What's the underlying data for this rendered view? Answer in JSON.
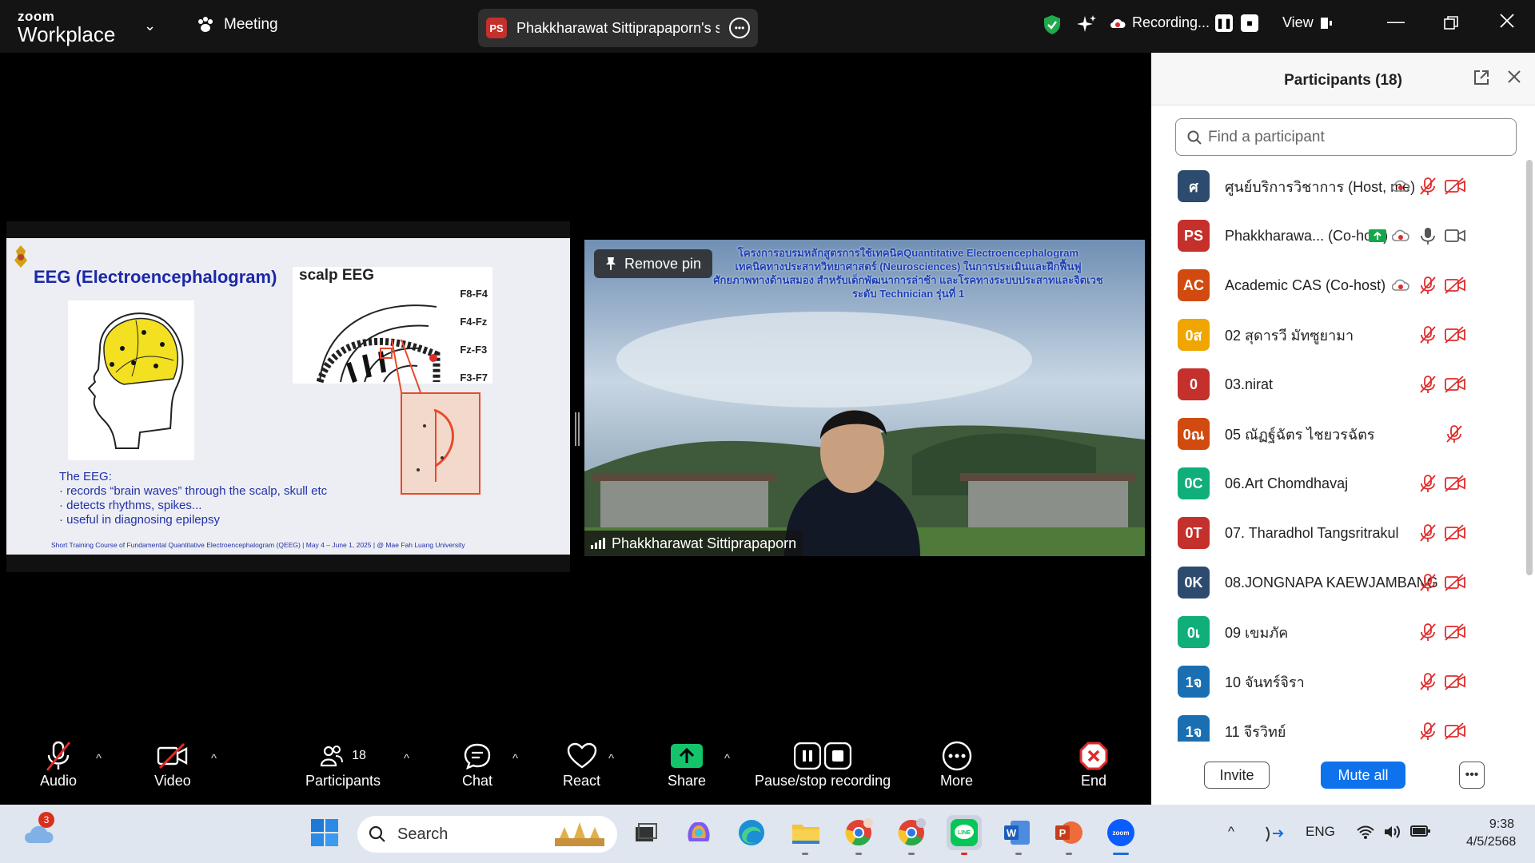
{
  "titlebar": {
    "logo_line1": "zoom",
    "logo_line2": "Workplace",
    "meeting_label": "Meeting",
    "share_initials": "PS",
    "share_title": "Phakkharawat Sittiprapaporn's screen",
    "recording_label": "Recording...",
    "view_label": "View"
  },
  "slide": {
    "title": "EEG (Electroencephalogram)",
    "scalp_label": "scalp EEG",
    "electrodes": [
      "F8-F4",
      "F4-Fz",
      "Fz-F3",
      "F3-F7"
    ],
    "body_heading": "The EEG:",
    "bullets": [
      "records “brain waves” through the scalp, skull etc",
      "detects rhythms, spikes...",
      "useful in diagnosing epilepsy"
    ],
    "footer": "Short Training Course of Fundamental Quantitative Electroencephalogram (QEEG) | May 4 – June 1, 2025 | @ Mae Fah Luang University"
  },
  "video": {
    "banner_line1": "โครงการอบรมหลักสูตรการใช้เทคนิคQuantitative Electroencephalogram",
    "banner_line2": "เทคนิคทางประสาทวิทยาศาสตร์ (Neurosciences) ในการประเมินและฝึกฟื้นฟู",
    "banner_line3": "ศักยภาพทางด้านสมอง สำหรับเด็กพัฒนาการล่าช้า และโรคทางระบบประสาทและจิตเวช",
    "banner_line4": "ระดับ Technician รุ่นที่ 1",
    "pin_label": "Remove pin",
    "speaker_name": "Phakkharawat Sittiprapaporn"
  },
  "toolbar": {
    "audio": "Audio",
    "video": "Video",
    "participants": "Participants",
    "participants_count": "18",
    "chat": "Chat",
    "react": "React",
    "share": "Share",
    "pause_stop": "Pause/stop recording",
    "more": "More",
    "end": "End"
  },
  "panel": {
    "title": "Participants (18)",
    "search_placeholder": "Find a participant",
    "invite": "Invite",
    "mute_all": "Mute all",
    "participants": [
      {
        "initials": "ศ",
        "name": "ศูนย์บริการวิชาการ (Host, me)",
        "color": "#2d4b6e"
      },
      {
        "initials": "PS",
        "name": "Phakkharawa... (Co-host)",
        "color": "#c4302b"
      },
      {
        "initials": "AC",
        "name": "Academic CAS (Co-host)",
        "color": "#d14a0f"
      },
      {
        "initials": "0ส",
        "name": "02 สุดารวี มัทซูยามา",
        "color": "#f0a500"
      },
      {
        "initials": "0",
        "name": "03.nirat",
        "color": "#c4302b"
      },
      {
        "initials": "0ณ",
        "name": "05 ณัฏฐ์ฉัตร ไชยวรฉัตร",
        "color": "#d14a0f"
      },
      {
        "initials": "0C",
        "name": "06.Art Chomdhavaj",
        "color": "#0fae7a"
      },
      {
        "initials": "0T",
        "name": "07. Tharadhol Tangsritrakul",
        "color": "#c4302b"
      },
      {
        "initials": "0K",
        "name": "08.JONGNAPA KAEWJAMBANG",
        "color": "#2d4b6e"
      },
      {
        "initials": "0เ",
        "name": "09 เขมภัค",
        "color": "#0fae7a"
      },
      {
        "initials": "1จ",
        "name": "10 จันทร์จิรา",
        "color": "#1a6fb3"
      },
      {
        "initials": "1จ",
        "name": "11 จีรวิทย์",
        "color": "#1a6fb3"
      }
    ]
  },
  "taskbar": {
    "search_label": "Search",
    "weather_badge": "3",
    "language": "ENG",
    "time": "9:38",
    "date": "4/5/2568"
  }
}
